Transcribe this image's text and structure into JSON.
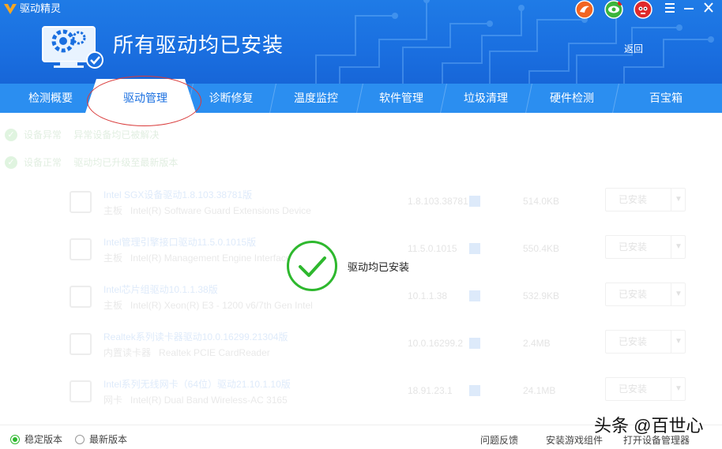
{
  "app": {
    "name": "驱动精灵",
    "hero_title": "所有驱动均已安装",
    "back_label": "返回"
  },
  "tabs": [
    {
      "label": "检测概要",
      "active": false
    },
    {
      "label": "驱动管理",
      "active": true
    },
    {
      "label": "诊断修复",
      "active": false
    },
    {
      "label": "温度监控",
      "active": false
    },
    {
      "label": "软件管理",
      "active": false
    },
    {
      "label": "垃圾清理",
      "active": false
    },
    {
      "label": "硬件检测",
      "active": false
    },
    {
      "label": "百宝箱",
      "active": false
    }
  ],
  "status_lines": [
    {
      "title": "设备异常",
      "text": "异常设备均已被解决"
    },
    {
      "title": "设备正常",
      "text": "驱动均已升级至最新版本"
    }
  ],
  "drivers": [
    {
      "name": "Intel SGX设备驱动1.8.103.38781版",
      "type": "主板",
      "desc": "Intel(R) Software Guard Extensions Device",
      "version": "1.8.103.38781",
      "size": "514.0KB",
      "action": "已安装",
      "icon": "chip-icon"
    },
    {
      "name": "Intel管理引擎接口驱动11.5.0.1015版",
      "type": "主板",
      "desc": "Intel(R) Management Engine Interface",
      "version": "11.5.0.1015",
      "size": "550.4KB",
      "action": "已安装",
      "icon": "chip-icon"
    },
    {
      "name": "Intel芯片组驱动10.1.1.38版",
      "type": "主板",
      "desc": "Intel(R) Xeon(R) E3 - 1200 v6/7th Gen Intel",
      "version": "10.1.1.38",
      "size": "532.9KB",
      "action": "已安装",
      "icon": "chip-icon"
    },
    {
      "name": "Realtek系列读卡器驱动10.0.16299.21304版",
      "type": "内置读卡器",
      "desc": "Realtek PCIE CardReader",
      "version": "10.0.16299.2",
      "size": "2.4MB",
      "action": "已安装",
      "icon": "card-reader-icon"
    },
    {
      "name": "Intel系列无线网卡（64位）驱动21.10.1.10版",
      "type": "网卡",
      "desc": "Intel(R) Dual Band Wireless-AC 3165",
      "version": "18.91.23.1",
      "size": "24.1MB",
      "action": "已安装",
      "icon": "network-card-icon"
    }
  ],
  "overlay": {
    "message": "驱动均已安装",
    "icon": "check-circle-icon"
  },
  "footer": {
    "radio_stable": "稳定版本",
    "radio_latest": "最新版本",
    "selected": "stable",
    "link_feedback": "问题反馈",
    "link_game_components": "安装游戏组件",
    "link_device_manager": "打开设备管理器"
  },
  "watermark": "头条 @百世心",
  "colors": {
    "header_blue": "#1a6fe0",
    "tab_blue": "#2b8ef0",
    "success_green": "#2eb82e",
    "annotation_red": "#d93a3a"
  }
}
